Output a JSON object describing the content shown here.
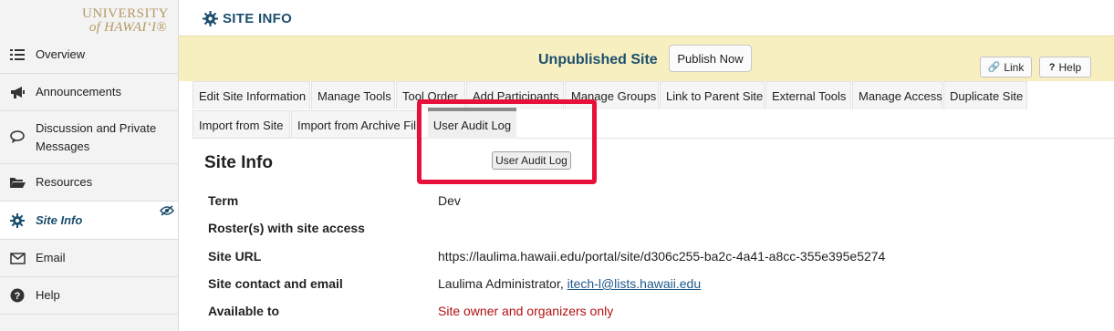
{
  "logo": {
    "line1": "UNIVERSITY",
    "line2": "of HAWAI‘I®"
  },
  "sidebar": {
    "items": [
      {
        "label": "Overview",
        "icon": "list-icon"
      },
      {
        "label": "Announcements",
        "icon": "megaphone-icon"
      },
      {
        "label": "Discussion and Private Messages",
        "icon": "chat-icon"
      },
      {
        "label": "Resources",
        "icon": "folder-icon"
      },
      {
        "label": "Site Info",
        "icon": "gear-icon",
        "active": true
      },
      {
        "label": "Email",
        "icon": "envelope-icon"
      },
      {
        "label": "Help",
        "icon": "question-circle-icon"
      }
    ]
  },
  "header": {
    "title": "SITE INFO"
  },
  "banner": {
    "status": "Unpublished Site",
    "publish_label": "Publish Now",
    "link_label": "Link",
    "help_label": "Help"
  },
  "tabs": {
    "row1": [
      "Edit Site Information",
      "Manage Tools",
      "Tool Order",
      "Add Participants",
      "Manage Groups",
      "Link to Parent Site",
      "External Tools",
      "Manage Access",
      "Duplicate Site"
    ],
    "row2": [
      "Import from Site",
      "Import from Archive File"
    ],
    "active": "User Audit Log"
  },
  "audit_button_label": "User Audit Log",
  "content": {
    "heading": "Site Info",
    "rows": [
      {
        "label": "Term",
        "value": "Dev"
      },
      {
        "label": "Roster(s) with site access",
        "value": ""
      },
      {
        "label": "Site URL",
        "value": "https://laulima.hawaii.edu/portal/site/d306c255-ba2c-4a41-a8cc-355e395e5274"
      },
      {
        "label": "Site contact and email",
        "value": "Laulima Administrator, ",
        "link": "itech-l@lists.hawaii.edu"
      },
      {
        "label": "Available to",
        "value": "Site owner and organizers only"
      }
    ]
  },
  "colors": {
    "accent": "#1c4f6e",
    "banner_bg": "#f8efc0",
    "highlight": "#e8103a",
    "warning_text": "#b30f0f"
  }
}
